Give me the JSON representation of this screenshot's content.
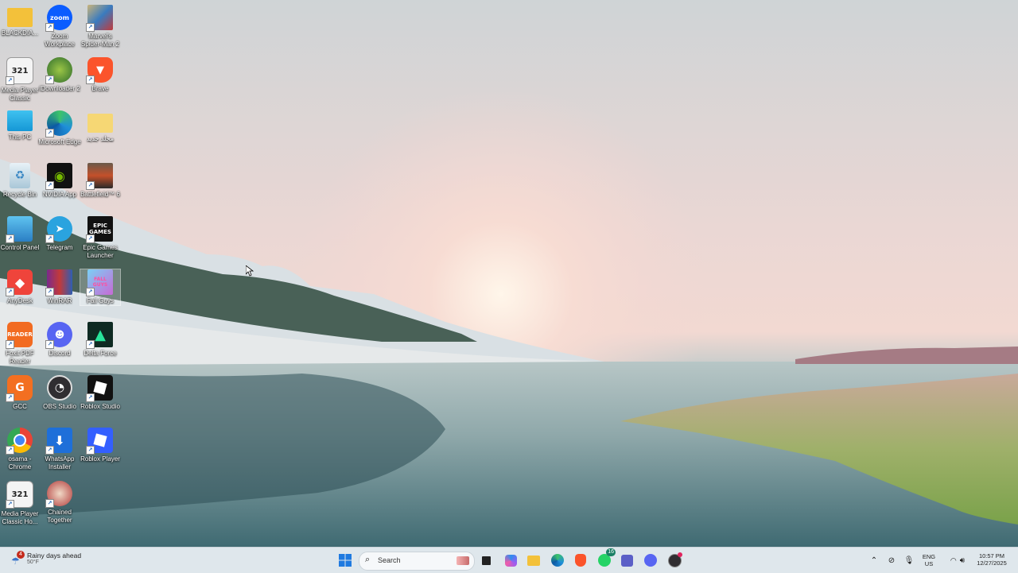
{
  "desktop": {
    "icons": [
      {
        "label": "BLACKDIA...",
        "icon": "folder-icon"
      },
      {
        "label": "Zoom Workplace",
        "icon": "zoom-icon",
        "overlay": "zoom"
      },
      {
        "label": "Marvel's Spider-Man 2",
        "icon": "spiderman-game-icon"
      },
      {
        "label": "Media Player Classic",
        "icon": "media-player-icon",
        "overlay": "321"
      },
      {
        "label": "IDownloader 2",
        "icon": "downloader-icon"
      },
      {
        "label": "Brave",
        "icon": "brave-icon"
      },
      {
        "label": "This PC",
        "icon": "monitor-icon"
      },
      {
        "label": "Microsoft Edge",
        "icon": "edge-icon"
      },
      {
        "label": "مجلد جديد",
        "icon": "folder-icon"
      },
      {
        "label": "Recycle Bin",
        "icon": "recycle-bin-icon"
      },
      {
        "label": "NVIDIA App",
        "icon": "nvidia-icon"
      },
      {
        "label": "Battlefield™ 6",
        "icon": "battlefield-game-icon"
      },
      {
        "label": "Control Panel",
        "icon": "control-panel-icon"
      },
      {
        "label": "Telegram",
        "icon": "telegram-icon"
      },
      {
        "label": "Epic Games Launcher",
        "icon": "epic-games-icon",
        "overlay": "EPIC GAMES"
      },
      {
        "label": "AnyDesk",
        "icon": "anydesk-icon"
      },
      {
        "label": "WinRAR",
        "icon": "winrar-icon"
      },
      {
        "label": "Fall Guys",
        "icon": "fall-guys-game-icon",
        "overlay": "FALL GUYS"
      },
      {
        "label": "Foxit PDF Reader",
        "icon": "foxit-reader-icon",
        "overlay": "READER"
      },
      {
        "label": "Discord",
        "icon": "discord-icon"
      },
      {
        "label": "Delta Force",
        "icon": "delta-force-icon"
      },
      {
        "label": "GCC",
        "icon": "gcc-icon"
      },
      {
        "label": "OBS Studio",
        "icon": "obs-icon"
      },
      {
        "label": "Roblox Studio",
        "icon": "roblox-studio-icon"
      },
      {
        "label": "osama - Chrome",
        "icon": "chrome-icon"
      },
      {
        "label": "WhatsApp Installer",
        "icon": "whatsapp-installer-icon"
      },
      {
        "label": "Roblox Player",
        "icon": "roblox-player-icon"
      },
      {
        "label": "Media Player Classic Ho...",
        "icon": "media-player-icon",
        "overlay": "321"
      },
      {
        "label": "Chained Together",
        "icon": "chained-together-game-icon"
      }
    ]
  },
  "taskbar": {
    "weather": {
      "title": "Rainy days ahead",
      "temp": "50°F",
      "badge": "4"
    },
    "search": {
      "placeholder": "Search"
    },
    "apps": [
      {
        "name": "start",
        "icon": "windows-start-icon"
      },
      {
        "name": "task-view",
        "icon": "task-view-icon"
      },
      {
        "name": "copilot",
        "icon": "copilot-icon"
      },
      {
        "name": "file-explorer",
        "icon": "file-explorer-icon"
      },
      {
        "name": "edge",
        "icon": "edge-icon"
      },
      {
        "name": "brave",
        "icon": "brave-icon"
      },
      {
        "name": "whatsapp",
        "icon": "whatsapp-icon",
        "badge": "16"
      },
      {
        "name": "teams",
        "icon": "teams-icon"
      },
      {
        "name": "discord",
        "icon": "discord-icon"
      },
      {
        "name": "obs",
        "icon": "obs-icon"
      }
    ],
    "tray": {
      "lang_line1": "ENG",
      "lang_line2": "US",
      "time": "10:57 PM",
      "date": "12/27/2025"
    }
  }
}
